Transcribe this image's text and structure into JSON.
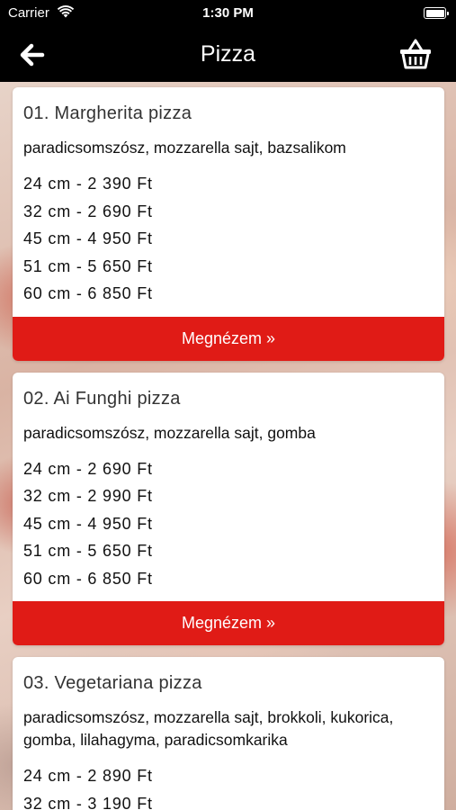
{
  "status_bar": {
    "carrier": "Carrier",
    "time": "1:30 PM",
    "battery_percent": 100
  },
  "nav": {
    "title": "Pizza",
    "back_icon": "arrow-left-icon",
    "cart_icon": "basket-icon"
  },
  "theme": {
    "accent": "#e01b16",
    "nav_bg": "#000000",
    "card_bg": "#ffffff"
  },
  "products": [
    {
      "name": "01. Margherita pizza",
      "description": "paradicsomszósz, mozzarella sajt, bazsalikom",
      "prices": [
        "24 cm - 2 390 Ft",
        "32 cm - 2 690 Ft",
        "45 cm - 4 950 Ft",
        "51 cm - 5 650 Ft",
        "60 cm - 6 850 Ft"
      ],
      "button_label": "Megnézem »"
    },
    {
      "name": "02. Ai Funghi pizza",
      "description": "paradicsomszósz, mozzarella sajt, gomba",
      "prices": [
        "24 cm - 2 690 Ft",
        "32 cm - 2 990 Ft",
        "45 cm - 4 950 Ft",
        "51 cm - 5 650 Ft",
        "60 cm - 6 850 Ft"
      ],
      "button_label": "Megnézem »"
    },
    {
      "name": "03. Vegetariana pizza",
      "description": "paradicsomszósz, mozzarella sajt, brokkoli, kukorica, gomba, lilahagyma, paradicsomkarika",
      "prices": [
        "24 cm - 2 890 Ft",
        "32 cm - 3 190 Ft"
      ],
      "button_label": ""
    }
  ]
}
